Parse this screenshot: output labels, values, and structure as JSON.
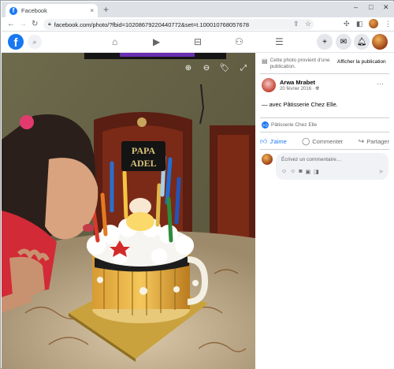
{
  "browser": {
    "tab_title": "Facebook",
    "tab_close": "×",
    "new_tab": "+",
    "url": "facebook.com/photo/?fbid=10208679220440772&set=t.100010768057678",
    "window_controls": [
      "–",
      "□",
      "✕"
    ]
  },
  "photo": {
    "cake_sign_line1": "PAPA",
    "cake_sign_line2": "ADEL"
  },
  "panel": {
    "notice_text": "Cette photo provient d'une publication.",
    "notice_link": "Afficher la publication",
    "author_name": "Arwa Mrabet",
    "post_date": "20 février 2016 · ",
    "more": "···",
    "caption": "— avec Pâtisserie Chez Elle.",
    "tagged_page": "Pâtisserie Chez Elle",
    "actions": {
      "like": "J'aime",
      "comment": "Commenter",
      "share": "Partager"
    },
    "comment_placeholder": "Écrivez un commentaire…"
  },
  "colors": {
    "facebook_blue": "#1877f2",
    "secondary_text": "#65676b"
  },
  "icons": {
    "like": "thumbs-up-icon",
    "comment": "speech-bubble-icon",
    "share": "share-arrow-icon"
  }
}
